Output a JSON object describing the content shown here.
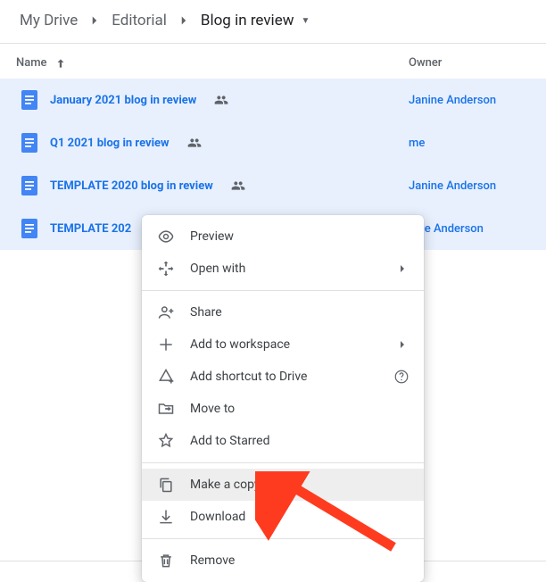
{
  "breadcrumb": {
    "items": [
      "My Drive",
      "Editorial",
      "Blog in review"
    ]
  },
  "columns": {
    "name": "Name",
    "owner": "Owner"
  },
  "files": [
    {
      "name": "January 2021 blog in review",
      "owner": "Janine Anderson",
      "shared": true
    },
    {
      "name": "Q1 2021 blog in review",
      "owner": "me",
      "shared": true
    },
    {
      "name": "TEMPLATE 2020 blog in review",
      "owner": "Janine Anderson",
      "shared": true
    },
    {
      "name": "TEMPLATE 202",
      "owner": "nine Anderson",
      "shared": true
    }
  ],
  "menu": {
    "preview": "Preview",
    "open_with": "Open with",
    "share": "Share",
    "add_to_workspace": "Add to workspace",
    "add_shortcut": "Add shortcut to Drive",
    "move_to": "Move to",
    "add_to_starred": "Add to Starred",
    "make_a_copy": "Make a copy",
    "download": "Download",
    "remove": "Remove"
  }
}
